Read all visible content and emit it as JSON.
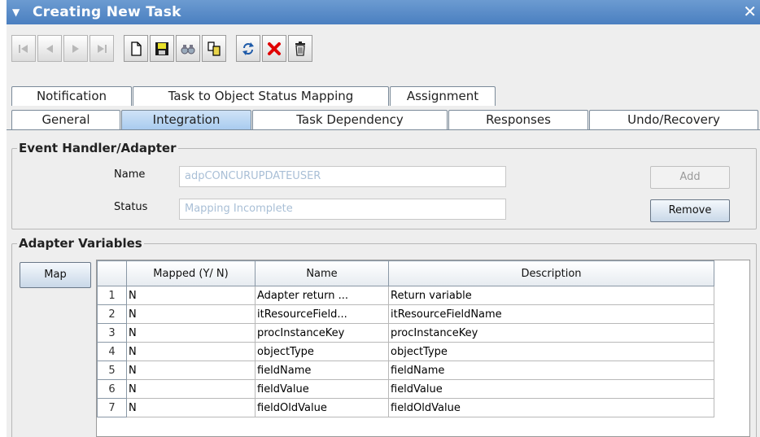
{
  "window": {
    "title": "Creating New Task"
  },
  "toolbar": {
    "buttons": [
      "first-icon",
      "previous-icon",
      "next-icon",
      "last-icon",
      "new-icon",
      "save-icon",
      "find-icon",
      "copy-icon",
      "refresh-icon",
      "cancel-icon",
      "delete-icon"
    ]
  },
  "tabs": {
    "row1": [
      "Notification",
      "Task to Object Status Mapping",
      "Assignment"
    ],
    "row2": [
      "General",
      "Integration",
      "Task Dependency",
      "Responses",
      "Undo/Recovery"
    ],
    "active": "Integration"
  },
  "event_handler": {
    "legend": "Event Handler/Adapter",
    "name_label": "Name",
    "name_value": "adpCONCURUPDATEUSER",
    "status_label": "Status",
    "status_value": "Mapping Incomplete",
    "add_label": "Add",
    "remove_label": "Remove"
  },
  "adapter_variables": {
    "legend": "Adapter Variables",
    "map_label": "Map",
    "columns": [
      "Mapped (Y/ N)",
      "Name",
      "Description"
    ],
    "rows": [
      {
        "num": "1",
        "mapped": "N",
        "name": "Adapter return ...",
        "description": "Return variable"
      },
      {
        "num": "2",
        "mapped": "N",
        "name": "itResourceField...",
        "description": "itResourceFieldName"
      },
      {
        "num": "3",
        "mapped": "N",
        "name": "procInstanceKey",
        "description": "procInstanceKey"
      },
      {
        "num": "4",
        "mapped": "N",
        "name": "objectType",
        "description": "objectType"
      },
      {
        "num": "5",
        "mapped": "N",
        "name": "fieldName",
        "description": "fieldName"
      },
      {
        "num": "6",
        "mapped": "N",
        "name": "fieldValue",
        "description": "fieldValue"
      },
      {
        "num": "7",
        "mapped": "N",
        "name": "fieldOldValue",
        "description": "fieldOldValue"
      }
    ]
  },
  "colors": {
    "title_bar": "#4a7fc0",
    "active_tab": "#a9cbef",
    "field_text": "#a9bfd6",
    "delete_red": "#e00000"
  }
}
